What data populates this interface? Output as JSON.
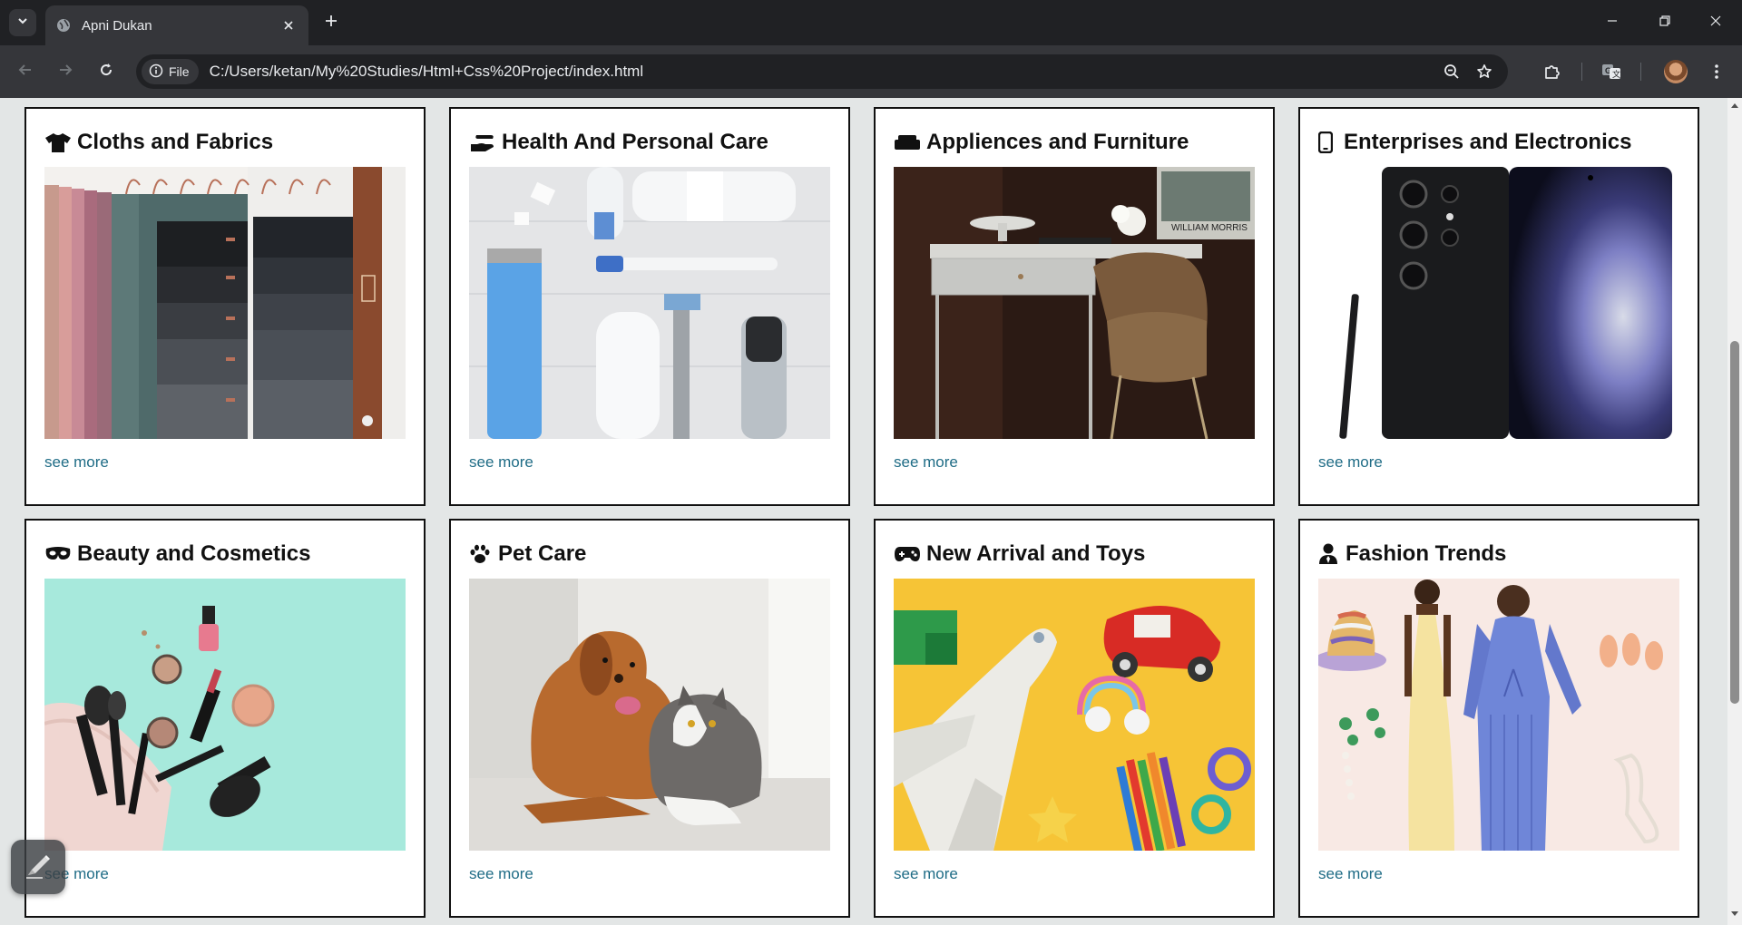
{
  "browser": {
    "tab_title": "Apni Dukan",
    "site_chip": "File",
    "url": "C:/Users/ketan/My%20Studies/Html+Css%20Project/index.html"
  },
  "icons": {
    "tab_search": "chevron-down-icon",
    "favicon": "globe-icon",
    "tab_close": "close-icon",
    "new_tab": "plus-icon",
    "back": "arrow-left-icon",
    "forward": "arrow-right-icon",
    "reload": "reload-icon",
    "info": "info-icon",
    "zoom": "zoom-out-icon",
    "bookmark": "star-icon",
    "extensions": "puzzle-icon",
    "translate": "translate-icon",
    "menu": "kebab-menu-icon"
  },
  "colors": {
    "link": "#1f6c86",
    "page_bg": "#e3e6e6",
    "card_border": "#111111"
  },
  "categories": [
    {
      "icon": "tshirt-icon",
      "title": "Cloths and Fabrics",
      "link": "see more"
    },
    {
      "icon": "hand-holding-icon",
      "title": "Health And Personal Care",
      "link": "see more"
    },
    {
      "icon": "couch-icon",
      "title": "Appliences and Furniture",
      "link": "see more"
    },
    {
      "icon": "mobile-phone-icon",
      "title": "Enterprises and Electronics",
      "link": "see more"
    },
    {
      "icon": "mask-icon",
      "title": "Beauty and Cosmetics",
      "link": "see more"
    },
    {
      "icon": "paw-icon",
      "title": "Pet Care",
      "link": "see more"
    },
    {
      "icon": "gamepad-icon",
      "title": "New Arrival and Toys",
      "link": "see more"
    },
    {
      "icon": "user-tie-icon",
      "title": "Fashion Trends",
      "link": "see more"
    }
  ]
}
